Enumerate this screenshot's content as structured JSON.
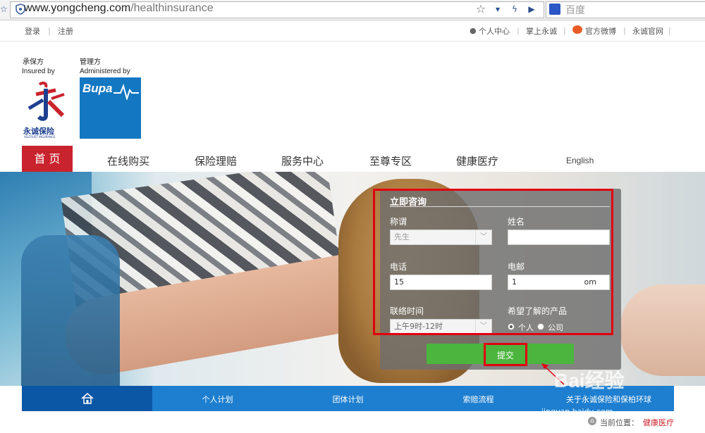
{
  "browser": {
    "url_domain": "www.yongcheng.com",
    "url_path": "/healthinsurance",
    "search_placeholder": "百度"
  },
  "topnav": {
    "login": "登录",
    "register": "注册",
    "personal_center": "个人中心",
    "mobile": "掌上永诚",
    "weibo": "官方微博",
    "official_site": "永诚官网"
  },
  "logos": {
    "insured_cn": "承保方",
    "insured_en": "Insured by",
    "insurer_name": "永诚保险",
    "insurer_name_en": "ALLTRUST INSURANCE",
    "admin_cn": "管理方",
    "admin_en": "Administered by",
    "admin_brand": "Bupa"
  },
  "mainnav": {
    "home": "首 页",
    "items": [
      "在线购买",
      "保险理赔",
      "服务中心",
      "至尊专区",
      "健康医疗"
    ],
    "english": "English"
  },
  "form": {
    "title": "立即咨询",
    "salutation_label": "称谓",
    "salutation_value": "先生",
    "name_label": "姓名",
    "name_value": "",
    "phone_label": "电话",
    "phone_value": "15",
    "email_label": "电邮",
    "email_value": "1",
    "email_tail": "om",
    "contact_time_label": "联络时间",
    "contact_time_value": "上午9时-12时",
    "product_label": "希望了解的产品",
    "option_personal": "个人",
    "option_company": "公司",
    "submit": "提交"
  },
  "bottomnav": {
    "items": [
      "个人计划",
      "团体计划",
      "索赔流程",
      "关于永诚保险和保柏环球"
    ]
  },
  "breadcrumb": {
    "label": "当前位置：",
    "current": "健康医疗"
  },
  "watermark": {
    "text": "Bai经验",
    "url": "jingyan.baidu.com"
  },
  "colors": {
    "brand_red": "#c9232d",
    "nav_blue": "#1e7fd0",
    "nav_dark_blue": "#0c57a5",
    "bupa_blue": "#1377c1",
    "submit_green": "#4bb53d",
    "highlight_red": "#e0000f"
  }
}
